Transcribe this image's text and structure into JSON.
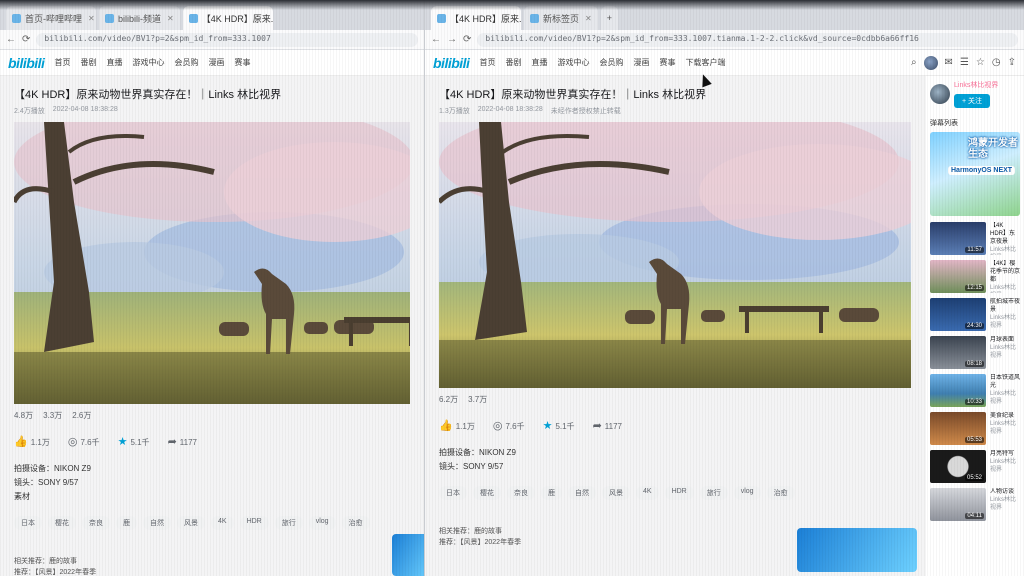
{
  "left_window": {
    "tabs": [
      {
        "label": "首页-哔哩哔哩"
      },
      {
        "label": "bilibili-频道"
      },
      {
        "label": "【4K HDR】原来..."
      }
    ],
    "url": "bilibili.com/video/BV1?p=2&spm_id_from=333.1007",
    "logo": "bilibili",
    "nav": [
      "首页",
      "番剧",
      "直播",
      "游戏中心",
      "会员购",
      "漫画",
      "赛事"
    ],
    "video": {
      "title": "【4K HDR】原来动物世界真实存在！｜Links 林比视界",
      "meta": [
        "2.4万播放",
        "2022-04-08 18:38:28"
      ],
      "stats": [
        "4.8万",
        "3.3万",
        "2.6万"
      ],
      "actions": [
        {
          "icon": "thumbs-up-icon",
          "label": "1.1万"
        },
        {
          "icon": "coin-icon",
          "label": "7.6千"
        },
        {
          "icon": "star-icon",
          "label": "5.1千"
        },
        {
          "icon": "share-icon",
          "label": "1177"
        }
      ],
      "desc": [
        "拍摄设备：NIKON Z9",
        "镜头：SONY 9/57",
        "素材"
      ],
      "tags": [
        "日本",
        "樱花",
        "奈良",
        "鹿",
        "自然",
        "风景",
        "4K",
        "HDR",
        "旅行",
        "vlog",
        "治愈"
      ],
      "bottomnote": [
        "相关推荐：鹿的故事",
        "推荐：【风景】2022年春季"
      ]
    }
  },
  "right_window": {
    "tabs": [
      {
        "label": "【4K HDR】原来..."
      },
      {
        "label": "新标签页"
      }
    ],
    "url": "bilibili.com/video/BV1?p=2&spm_id_from=333.1007.tianma.1-2-2.click&vd_source=0cdbb6a66ff16",
    "logo": "bilibili",
    "nav": [
      "首页",
      "番剧",
      "直播",
      "游戏中心",
      "会员购",
      "漫画",
      "赛事",
      "下载客户端"
    ],
    "video": {
      "title": "【4K HDR】原来动物世界真实存在！｜Links 林比视界",
      "meta": [
        "1.3万播放",
        "2022-04-08 18:38:28",
        "未经作者授权禁止转载"
      ],
      "stats": [
        "6.2万",
        "3.7万"
      ],
      "actions": [
        {
          "icon": "thumbs-up-icon",
          "label": "1.1万"
        },
        {
          "icon": "coin-icon",
          "label": "7.6千"
        },
        {
          "icon": "star-icon",
          "label": "5.1千"
        },
        {
          "icon": "share-icon",
          "label": "1177"
        }
      ],
      "desc": [
        "拍摄设备：NIKON Z9",
        "镜头：SONY 9/57"
      ],
      "tags": [
        "日本",
        "樱花",
        "奈良",
        "鹿",
        "自然",
        "风景",
        "4K",
        "HDR",
        "旅行",
        "vlog",
        "治愈"
      ],
      "bottomnote": [
        "相关推荐：鹿的故事",
        "推荐：【风景】2022年春季"
      ]
    },
    "sidebar": {
      "uploader": "Links林比视界",
      "follow": "+ 关注",
      "section": "弹幕列表",
      "promo_title": "鸿蒙开发者生态",
      "promo_sub": "HarmonyOS NEXT",
      "recs": [
        {
          "title": "【4K HDR】东京夜景",
          "up": "Links林比视界",
          "dur": "11:57"
        },
        {
          "title": "【4K】樱花季节的京都",
          "up": "Links林比视界",
          "dur": "12:15"
        },
        {
          "title": "航拍城市夜景",
          "up": "Links林比视界",
          "dur": "24:30"
        },
        {
          "title": "月球表面",
          "up": "Links林比视界",
          "dur": "08:18"
        },
        {
          "title": "日本铁道风光",
          "up": "Links林比视界",
          "dur": "10:33"
        },
        {
          "title": "美食纪录",
          "up": "Links林比视界",
          "dur": "05:53"
        },
        {
          "title": "月亮特写",
          "up": "Links林比视界",
          "dur": "05:52"
        },
        {
          "title": "人物访谈",
          "up": "Links林比视界",
          "dur": "04:11"
        }
      ]
    }
  }
}
